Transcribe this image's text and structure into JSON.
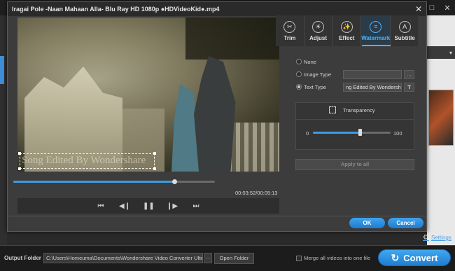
{
  "dialog": {
    "title": "Iragai Pole -Naan Mahaan Alla- Blu Ray HD 1080p ●HDVideoKid●.mp4",
    "close_glyph": "✕"
  },
  "player": {
    "watermark_text": "Song Edited By Wondershare",
    "progress_fraction": 0.8,
    "time": "00:03:52/00:05:13",
    "controls": {
      "prev": "⏮",
      "step_back": "◀❙",
      "pause": "❚❚",
      "step_forward": "❙▶",
      "next": "⏭"
    }
  },
  "tabs": [
    {
      "label": "Trim",
      "glyph": "✂",
      "icon": "scissors-icon",
      "active": false
    },
    {
      "label": "Adjust",
      "glyph": "☀",
      "icon": "adjust-icon",
      "active": false
    },
    {
      "label": "Effect",
      "glyph": "✨",
      "icon": "effect-icon",
      "active": false
    },
    {
      "label": "Watermark",
      "glyph": "≡",
      "icon": "watermark-icon",
      "active": true
    },
    {
      "label": "Subtitle",
      "glyph": "A",
      "icon": "subtitle-icon",
      "active": false
    }
  ],
  "watermark": {
    "none_label": "None",
    "image_label": "Image Type",
    "image_value": "",
    "image_browse": "...",
    "text_label": "Text Type",
    "text_value": "ng Edited By Wondershare",
    "font_button": "T",
    "selected": "text",
    "transparency_label": "Transparency",
    "transparency_min": "0",
    "transparency_max": "100",
    "transparency_value": 60,
    "apply_all": "Apply to all"
  },
  "buttons": {
    "ok": "OK",
    "cancel": "Cancel"
  },
  "bottom": {
    "output_label": "Output Folder :",
    "output_path": "C:\\Users\\Homeuma\\Documents\\Wondershare Video Converter Ultimate\\",
    "browse": "...",
    "open_folder": "Open Folder",
    "merge_label": "Merge all videos into one file",
    "convert_glyph": "↻",
    "convert": "Convert",
    "settings": "Settings",
    "settings_glyph": "⚙"
  },
  "background": {
    "window_buttons": [
      "–",
      "□",
      "✕"
    ],
    "dropdown_glyph": "▾"
  },
  "colors": {
    "accent": "#3a9be5",
    "active_tab": "#4db3ff"
  }
}
